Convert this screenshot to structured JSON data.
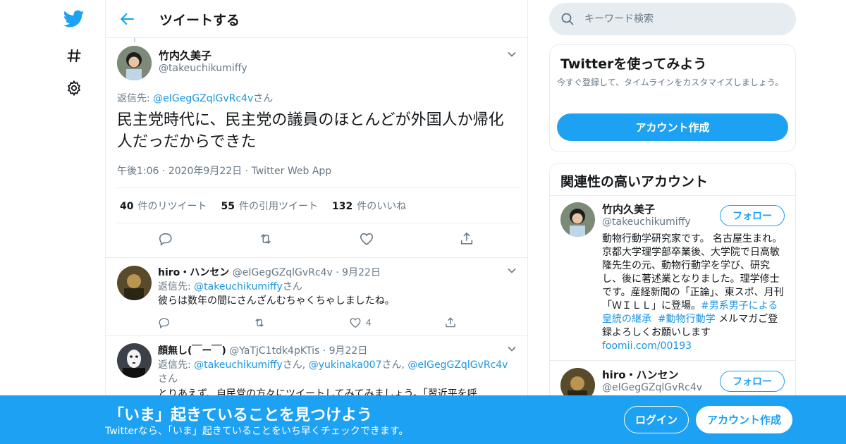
{
  "colors": {
    "accent": "#1da1f2",
    "link": "#1b95e0",
    "muted": "#657786",
    "border": "#e6ecf0",
    "like_pink": "#e0245e"
  },
  "nav": {
    "items": [
      "twitter-logo",
      "explore-hashtag",
      "settings-gear"
    ]
  },
  "header": {
    "title": "ツイートする"
  },
  "focus_tweet": {
    "name": "竹内久美子",
    "handle": "@takeuchikumiffy",
    "reply_prefix": "返信先: ",
    "reply_to": "@eIGegGZqlGvRc4v",
    "reply_suffix": "さん",
    "text": "民主党時代に、民主党の議員のほとんどが外国人か帰化人だっだからできた",
    "meta": "午後1:06 · 2020年9月22日 · Twitter Web App",
    "retweets": "40",
    "retweets_label": "件のリツイート",
    "quotes": "55",
    "quotes_label": "件の引用ツイート",
    "likes": "132",
    "likes_label": "件のいいね"
  },
  "replies": [
    {
      "name": "hiro・ハンセン",
      "handle_date": "@eIGegGZqlGvRc4v · 9月22日",
      "reply_prefix": "返信先: ",
      "reply_to": "@takeuchikumiffy",
      "reply_suffix": "さん",
      "text": "彼らは数年の間にさんざんむちゃくちゃしましたね。",
      "like_count": "4"
    },
    {
      "name": "顔無し(￣ー￣)",
      "handle_date": "@YaTjC1tdk4pKTis · 9月22日",
      "reply_prefix": "返信先: ",
      "reply_to_1": "@takeuchikumiffy",
      "reply_sep_1": "さん, ",
      "reply_to_2": "@yukinaka007",
      "reply_sep_2": "さん, ",
      "reply_to_3": "@eIGegGZqlGvRc4v",
      "reply_suffix": "さん",
      "text": "とりあえず、自民党の方々にツイートしてみてみましょう。「習近平を呼"
    }
  ],
  "search": {
    "placeholder": "キーワード検索"
  },
  "try_card": {
    "title": "Twitterを使ってみよう",
    "desc": "今すぐ登録して、タイムラインをカスタマイズしましょう。",
    "signup": "アカウント作成"
  },
  "related": {
    "title": "関連性の高いアカウント",
    "accounts": [
      {
        "name": "竹内久美子",
        "handle": "@takeuchikumiffy",
        "follow": "フォロー",
        "bio_text": "動物行動学研究家です。 名古屋生まれ。京都大学理学部卒業後、大学院で日高敏隆先生の元、動物行動学を学び、研究し、後に著述業となりました。理学修士です。産経新聞の「正論」、東スポ、月刊「ＷＩＬＬ」に登場。",
        "hashtag_1": "#男系男子による皇統の継承",
        "hashtag_2": "#動物行動学",
        "bio_tail": " メルマガご登録よろしくお願いします　",
        "bio_link": "foomii.com/00193"
      },
      {
        "name": "hiro・ハンセン",
        "handle": "@eIGegGZqlGvRc4v",
        "follow": "フォロー"
      }
    ]
  },
  "banner": {
    "title": "「いま」起きていることを見つけよう",
    "subtitle": "Twitterなら、「いま」起きていることをいち早くチェックできます。",
    "login": "ログイン",
    "signup": "アカウント作成"
  }
}
